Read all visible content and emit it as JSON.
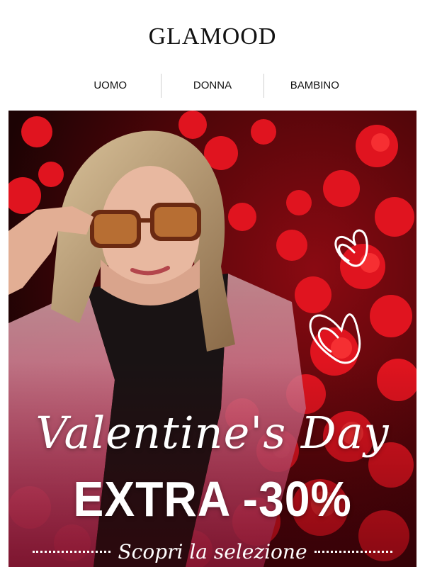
{
  "brand": {
    "name": "GLAMOOD"
  },
  "nav": {
    "items": [
      {
        "label": "UOMO"
      },
      {
        "label": "DONNA"
      },
      {
        "label": "BAMBINO"
      }
    ]
  },
  "hero": {
    "title": "Valentine's Day",
    "offer": "EXTRA -30%",
    "cta": "Scopri la selezione",
    "image_description_icon": "woman-sunglasses-red-flowers-image",
    "colors": {
      "accent": "#c8102e",
      "dark": "#2a0608",
      "text": "#ffffff"
    }
  }
}
